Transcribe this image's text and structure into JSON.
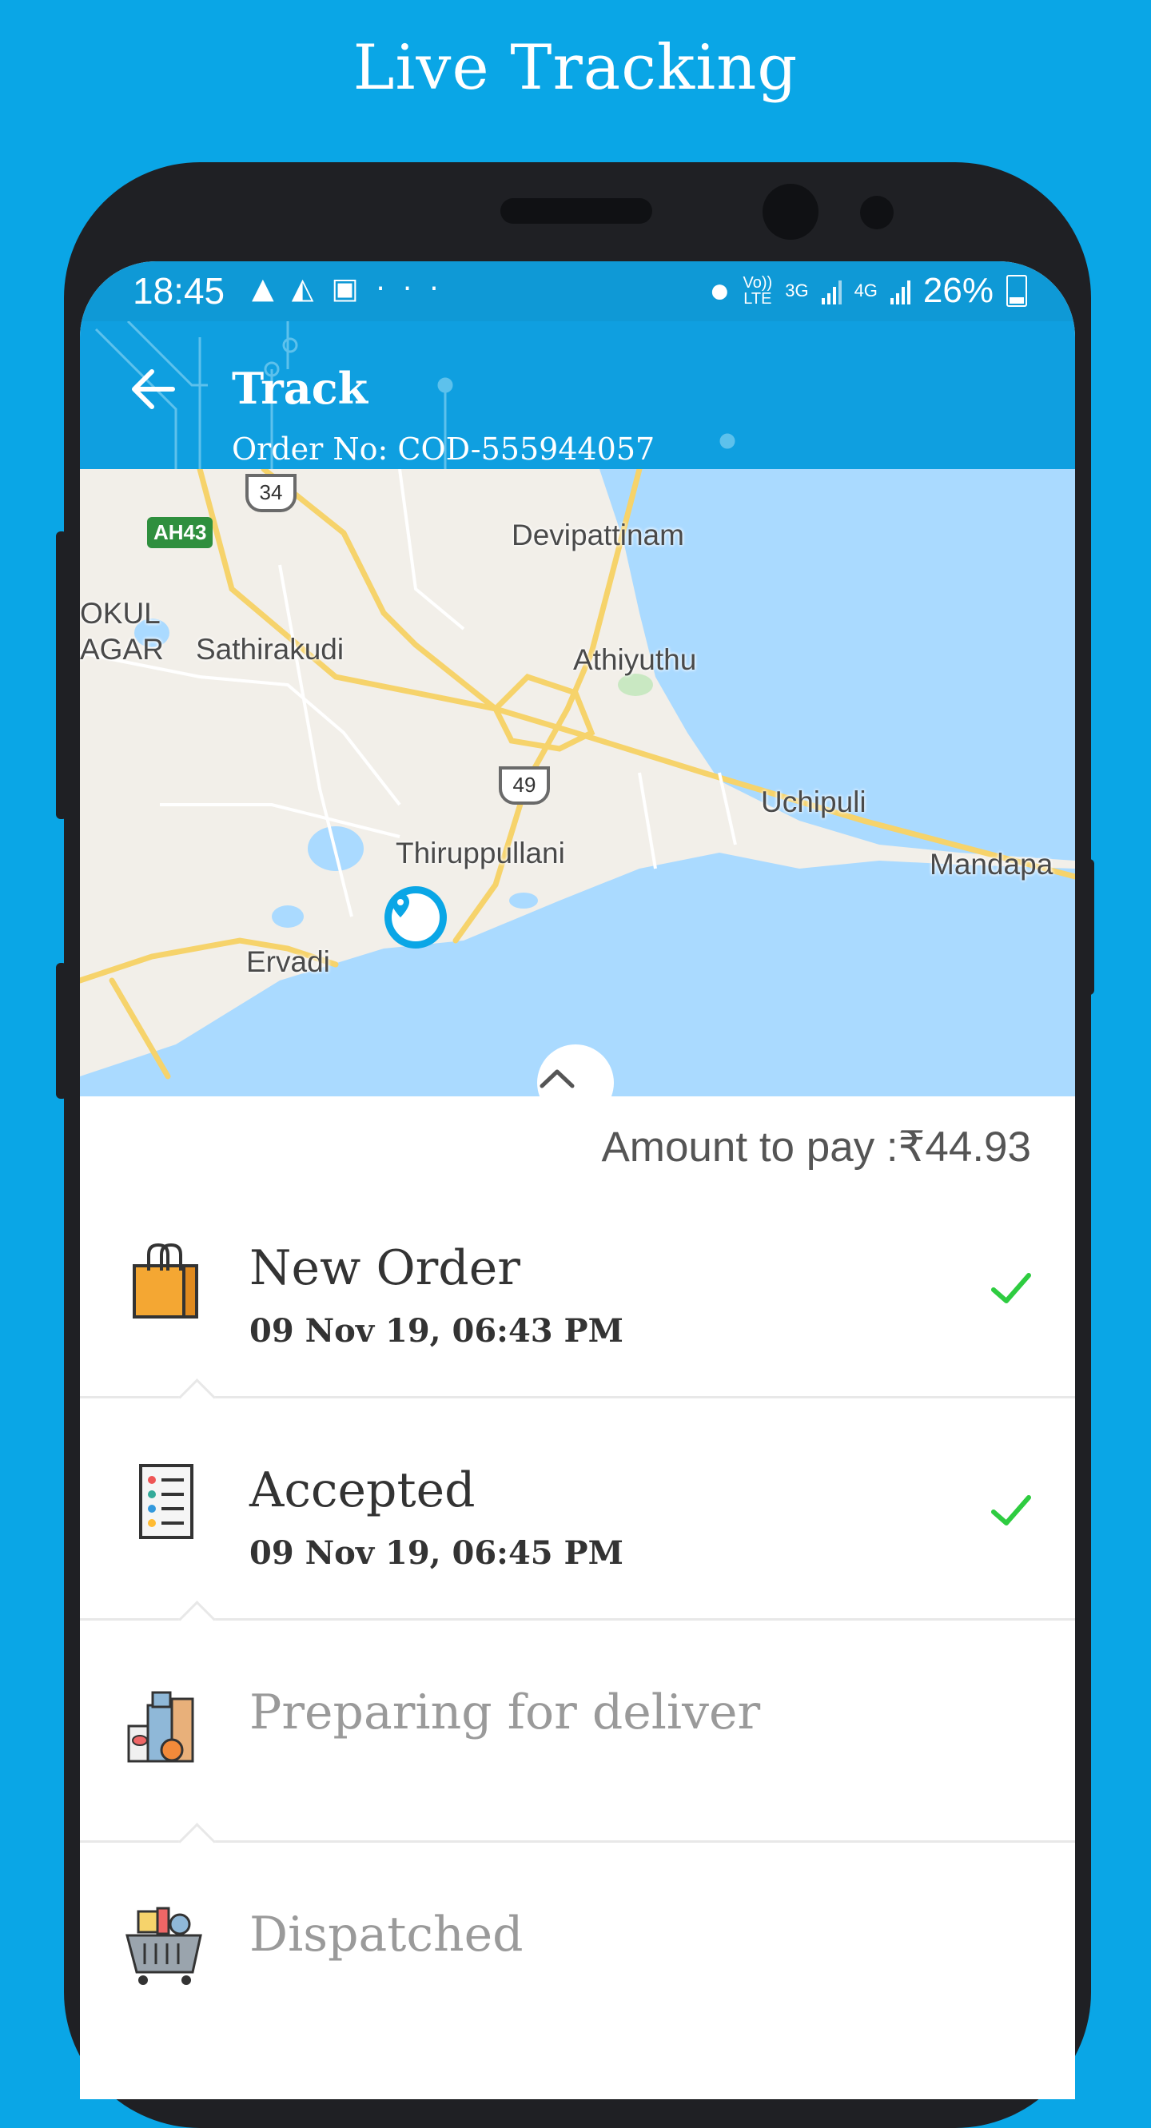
{
  "promo": {
    "title": "Live Tracking"
  },
  "status_bar": {
    "time": "18:45",
    "left_icons": [
      "navigation-icon",
      "maps-icon",
      "image-icon",
      "more-icon"
    ],
    "volte": "Vo))",
    "lte": "LTE",
    "net1": "3G",
    "net2": "4G",
    "battery": "26%"
  },
  "app_bar": {
    "title": "Track",
    "order_no": "Order No: COD-555944057"
  },
  "map": {
    "labels": {
      "devipattinam": "Devipattinam",
      "okul": "OKUL",
      "agar": "AGAR",
      "sathirakudi": "Sathirakudi",
      "athiyuthu": "Athiyuthu",
      "uchipuli": "Uchipuli",
      "thiruppullani": "Thiruppullani",
      "mandapa": "Mandapa",
      "ervadi": "Ervadi"
    },
    "route_34": "34",
    "route_49": "49",
    "route_ah43": "AH43"
  },
  "amount": {
    "text": "Amount to pay :₹44.93"
  },
  "steps": [
    {
      "title": "New Order",
      "time": "09 Nov 19, 06:43 PM",
      "done": true,
      "icon": "shopping-bag-icon"
    },
    {
      "title": "Accepted",
      "time": "09 Nov 19, 06:45 PM",
      "done": true,
      "icon": "checklist-icon"
    },
    {
      "title": "Preparing for deliver",
      "time": "",
      "done": false,
      "icon": "groceries-icon"
    },
    {
      "title": "Dispatched",
      "time": "",
      "done": false,
      "icon": "basket-icon"
    }
  ],
  "colors": {
    "background": "#0aa6e6",
    "appbar": "#0f9fe0",
    "check": "#2ecc40",
    "pending_text": "#9a9a9a"
  }
}
